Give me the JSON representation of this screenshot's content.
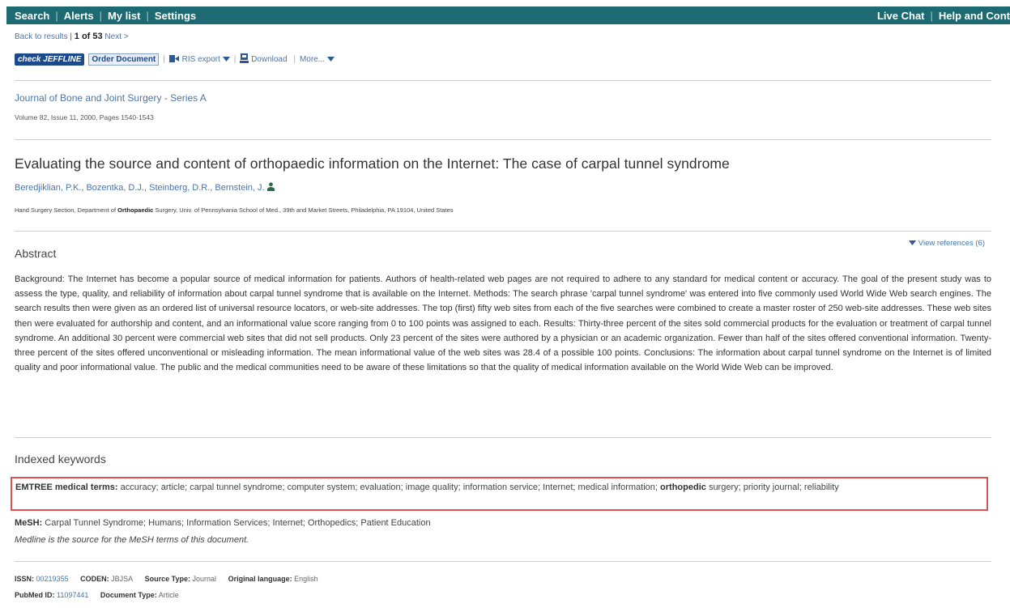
{
  "topbar": {
    "nav": [
      "Search",
      "Alerts",
      "My list",
      "Settings"
    ],
    "right": [
      "Live Chat",
      "Help and Cont"
    ]
  },
  "breadcrumb": {
    "back": "Back to results",
    "position": "1 of 53",
    "next": "Next >"
  },
  "toolbar": {
    "check_jeffline": "check JEFFLINE",
    "order_document": "Order Document",
    "ris_export": "RIS export",
    "download": "Download",
    "more": "More..."
  },
  "source": {
    "journal": "Journal of Bone and Joint Surgery - Series A",
    "volume": "Volume 82, Issue 11, 2000, Pages 1540-1543"
  },
  "article": {
    "title": "Evaluating the source and content of orthopaedic information on the Internet: The case of carpal tunnel syndrome",
    "authors": "Beredjiklian, P.K., Bozentka, D.J., Steinberg, D.R., Bernstein, J.",
    "affiliation_pre": "Hand Surgery Section, Department of ",
    "affiliation_bold": "Orthopaedic",
    "affiliation_post": " Surgery, Univ. of Pennsylvania School of Med., 39th and Market Streets, Philadelphia, PA 19104, United States"
  },
  "abstract": {
    "heading": "Abstract",
    "view_references": "View references (6)",
    "text": "Background: The Internet has become a popular source of medical information for patients. Authors of health-related web pages are not required to adhere to any standard for medical content or accuracy. The goal of the present study was to assess the type, quality, and reliability of information about carpal tunnel syndrome that is available on the Internet. Methods: The search phrase 'carpal tunnel syndrome' was entered into five commonly used World Wide Web search engines. The search results then were given as an ordered list of universal resource locators, or web-site addresses. The top (first) fifty web sites from each of the five searches were combined to create a master roster of 250 web-site addresses. These web sites then were evaluated for authorship and content, and an informational value score ranging from 0 to 100 points was assigned to each. Results: Thirty-three percent of the sites sold commercial products for the evaluation or treatment of carpal tunnel syndrome. An additional 30 percent were commercial web sites that did not sell products. Only 23 percent of the sites were authored by a physician or an academic organization. Fewer than half of the sites offered conventional information. Twenty-three percent of the sites offered unconventional or misleading information. The mean informational value of the web sites was 28.4 of a possible 100 points. Conclusions: The information about carpal tunnel syndrome on the Internet is of limited quality and poor informational value. The public and the medical communities need to be aware of these limitations so that the quality of medical information available on the World Wide Web can be improved."
  },
  "keywords": {
    "heading": "Indexed keywords",
    "emtree_label": "EMTREE medical terms:",
    "emtree_pre": "accuracy; article; carpal tunnel syndrome; computer system; evaluation; image quality; information service; Internet; medical information;",
    "emtree_bold": "orthopedic",
    "emtree_post": "surgery; priority journal; reliability",
    "mesh_label": "MeSH:",
    "mesh_terms": "Carpal Tunnel Syndrome; Humans; Information Services; Internet; Orthopedics; Patient Education",
    "medline_note": "Medline is the source for the MeSH terms of this document."
  },
  "meta": {
    "issn_label": "ISSN:",
    "issn": "00219355",
    "coden_label": "CODEN:",
    "coden": "JBJSA",
    "source_type_label": "Source Type:",
    "source_type": "Journal",
    "language_label": "Original language:",
    "language": "English",
    "pubmed_label": "PubMed ID:",
    "pubmed": "11097441",
    "doctype_label": "Document Type:",
    "doctype": "Article"
  },
  "colors": {
    "topbar": "#1d6a72",
    "link": "#4a76a8",
    "highlight_border": "#d9534f"
  }
}
